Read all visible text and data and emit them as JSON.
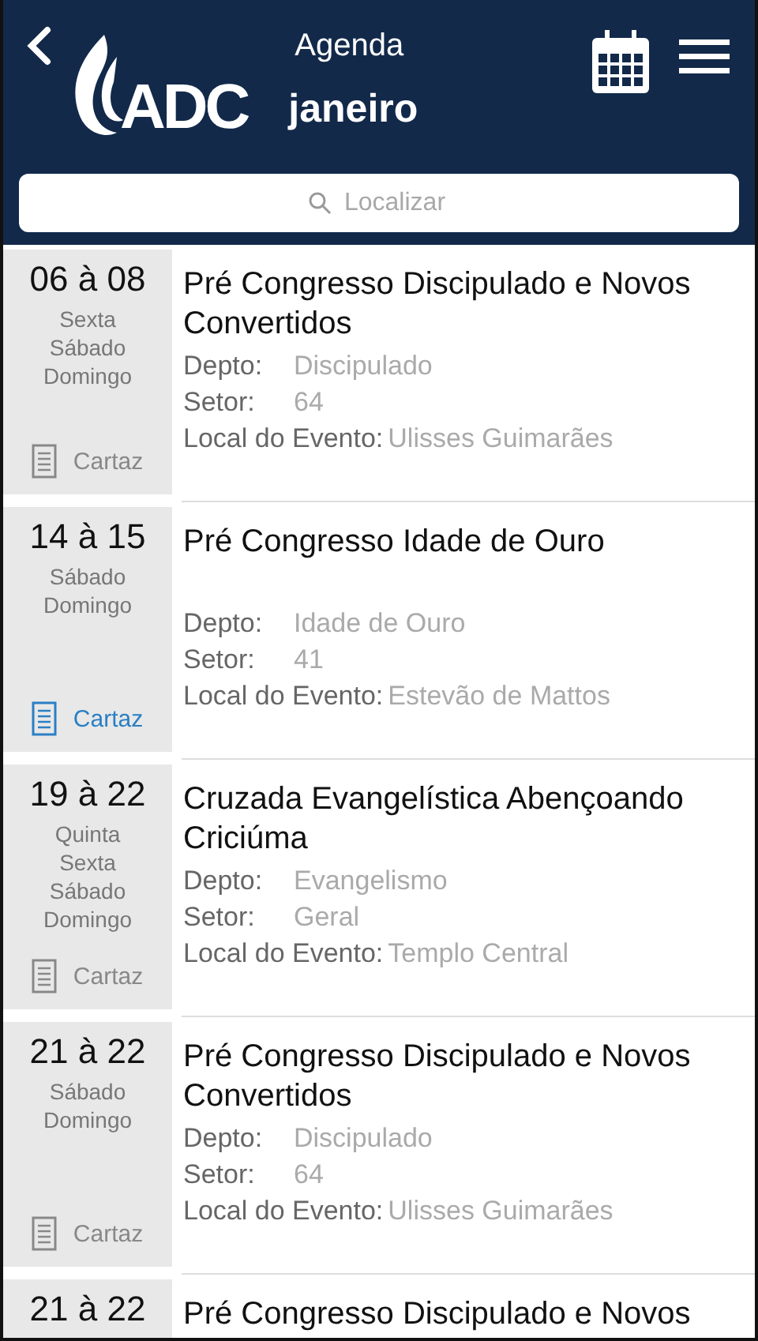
{
  "header": {
    "title": "Agenda",
    "logo_text": "ADC",
    "month": "janeiro"
  },
  "search": {
    "placeholder": "Localizar"
  },
  "events": [
    {
      "dates": "06 à 08",
      "days": [
        "Sexta",
        "Sábado",
        "Domingo"
      ],
      "poster": {
        "label": "Cartaz",
        "available": false
      },
      "title": "Pré Congresso Discipulado e Novos Convertidos",
      "fields": [
        {
          "label": "Depto:",
          "value": "Discipulado"
        },
        {
          "label": "Setor:",
          "value": "64"
        },
        {
          "label": "Local do Evento:",
          "value": "Ulisses Guimarães"
        }
      ]
    },
    {
      "dates": "14 à 15",
      "days": [
        "Sábado",
        "Domingo"
      ],
      "poster": {
        "label": "Cartaz",
        "available": true
      },
      "title": "Pré Congresso Idade de Ouro",
      "fields": [
        {
          "label": "Depto:",
          "value": "Idade de Ouro"
        },
        {
          "label": "Setor:",
          "value": "41"
        },
        {
          "label": "Local do Evento:",
          "value": "Estevão de Mattos"
        }
      ]
    },
    {
      "dates": "19 à 22",
      "days": [
        "Quinta",
        "Sexta",
        "Sábado",
        "Domingo"
      ],
      "poster": {
        "label": "Cartaz",
        "available": false
      },
      "title": "Cruzada Evangelística Abençoando Criciúma",
      "fields": [
        {
          "label": "Depto:",
          "value": "Evangelismo"
        },
        {
          "label": "Setor:",
          "value": "Geral"
        },
        {
          "label": "Local do Evento:",
          "value": "Templo Central"
        }
      ]
    },
    {
      "dates": "21 à 22",
      "days": [
        "Sábado",
        "Domingo"
      ],
      "poster": {
        "label": "Cartaz",
        "available": false
      },
      "title": "Pré Congresso Discipulado e Novos Convertidos",
      "fields": [
        {
          "label": "Depto:",
          "value": "Discipulado"
        },
        {
          "label": "Setor:",
          "value": "64"
        },
        {
          "label": "Local do Evento:",
          "value": "Ulisses Guimarães"
        }
      ]
    },
    {
      "dates": "21 à 22",
      "title": "Pré Congresso Discipulado e Novos"
    }
  ]
}
